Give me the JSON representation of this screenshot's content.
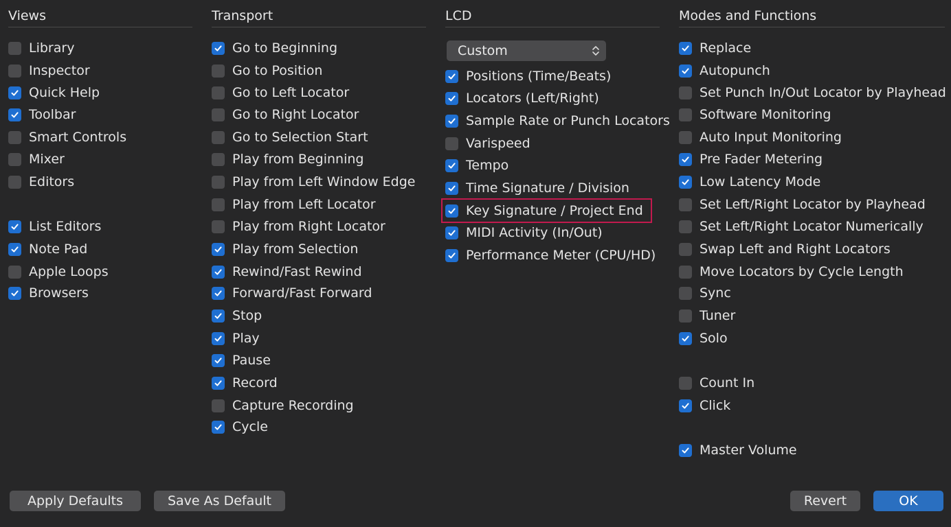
{
  "colors": {
    "accent": "#1f6fd1",
    "highlight": "#c21a4e",
    "background": "#272728"
  },
  "views": {
    "header": "Views",
    "items": [
      {
        "label": "Library",
        "checked": false
      },
      {
        "label": "Inspector",
        "checked": false
      },
      {
        "label": "Quick Help",
        "checked": true
      },
      {
        "label": "Toolbar",
        "checked": true
      },
      {
        "label": "Smart Controls",
        "checked": false
      },
      {
        "label": "Mixer",
        "checked": false
      },
      {
        "label": "Editors",
        "checked": false
      },
      {
        "label": "List Editors",
        "checked": true
      },
      {
        "label": "Note Pad",
        "checked": true
      },
      {
        "label": "Apple Loops",
        "checked": false
      },
      {
        "label": "Browsers",
        "checked": true
      }
    ]
  },
  "transport": {
    "header": "Transport",
    "items": [
      {
        "label": "Go to Beginning",
        "checked": true
      },
      {
        "label": "Go to Position",
        "checked": false
      },
      {
        "label": "Go to Left Locator",
        "checked": false
      },
      {
        "label": "Go to Right Locator",
        "checked": false
      },
      {
        "label": "Go to Selection Start",
        "checked": false
      },
      {
        "label": "Play from Beginning",
        "checked": false
      },
      {
        "label": "Play from Left Window Edge",
        "checked": false
      },
      {
        "label": "Play from Left Locator",
        "checked": false
      },
      {
        "label": "Play from Right Locator",
        "checked": false
      },
      {
        "label": "Play from Selection",
        "checked": true
      },
      {
        "label": "Rewind/Fast Rewind",
        "checked": true
      },
      {
        "label": "Forward/Fast Forward",
        "checked": true
      },
      {
        "label": "Stop",
        "checked": true
      },
      {
        "label": "Play",
        "checked": true
      },
      {
        "label": "Pause",
        "checked": true
      },
      {
        "label": "Record",
        "checked": true
      },
      {
        "label": "Capture Recording",
        "checked": false
      },
      {
        "label": "Cycle",
        "checked": true
      }
    ]
  },
  "lcd": {
    "header": "LCD",
    "select_value": "Custom",
    "items": [
      {
        "label": "Positions (Time/Beats)",
        "checked": true
      },
      {
        "label": "Locators (Left/Right)",
        "checked": true
      },
      {
        "label": "Sample Rate or Punch Locators",
        "checked": true
      },
      {
        "label": "Varispeed",
        "checked": false
      },
      {
        "label": "Tempo",
        "checked": true
      },
      {
        "label": "Time Signature / Division",
        "checked": true
      },
      {
        "label": "Key Signature / Project End",
        "checked": true
      },
      {
        "label": "MIDI Activity (In/Out)",
        "checked": true
      },
      {
        "label": "Performance Meter (CPU/HD)",
        "checked": true
      }
    ]
  },
  "modes": {
    "header": "Modes and Functions",
    "items": [
      {
        "label": "Replace",
        "checked": true
      },
      {
        "label": "Autopunch",
        "checked": true
      },
      {
        "label": "Set Punch In/Out Locator by Playhead",
        "checked": false
      },
      {
        "label": "Software Monitoring",
        "checked": false
      },
      {
        "label": "Auto Input Monitoring",
        "checked": false
      },
      {
        "label": "Pre Fader Metering",
        "checked": true
      },
      {
        "label": "Low Latency Mode",
        "checked": true
      },
      {
        "label": "Set Left/Right Locator by Playhead",
        "checked": false
      },
      {
        "label": "Set Left/Right Locator Numerically",
        "checked": false
      },
      {
        "label": "Swap Left and Right Locators",
        "checked": false
      },
      {
        "label": "Move Locators by Cycle Length",
        "checked": false
      },
      {
        "label": "Sync",
        "checked": false
      },
      {
        "label": "Tuner",
        "checked": false
      },
      {
        "label": "Solo",
        "checked": true
      },
      {
        "label": "Count In",
        "checked": false
      },
      {
        "label": "Click",
        "checked": true
      },
      {
        "label": "Master Volume",
        "checked": true
      }
    ]
  },
  "buttons": {
    "apply_defaults": "Apply Defaults",
    "save_as_default": "Save As Default",
    "revert": "Revert",
    "ok": "OK"
  }
}
